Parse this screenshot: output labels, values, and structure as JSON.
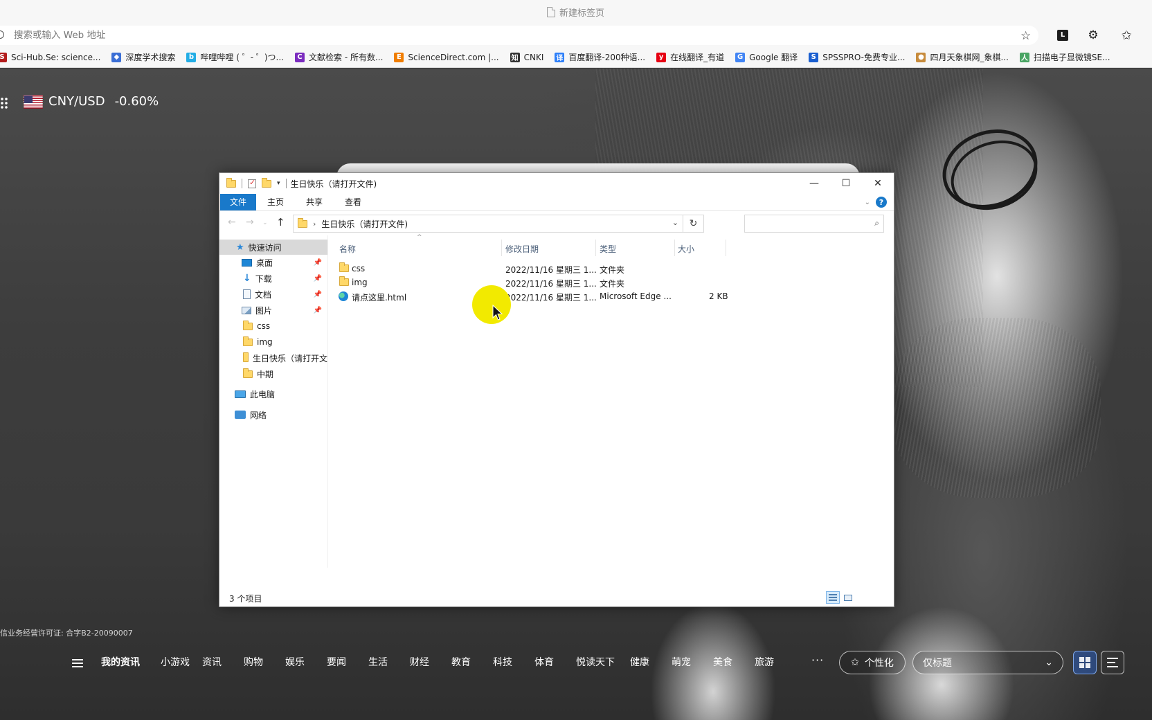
{
  "browser": {
    "tab_title": "新建标签页",
    "address_placeholder": "搜索或输入 Web 地址",
    "ext_label": "L",
    "bookmarks": [
      {
        "label": "Sci-Hub.Se: science...",
        "color": "#b31b1b",
        "glyph": "S"
      },
      {
        "label": "深度学术搜索",
        "color": "#3b6fd6",
        "glyph": "◆"
      },
      {
        "label": "哔哩哔哩 ( ゜- ゜)つ...",
        "color": "#23ade5",
        "glyph": "b"
      },
      {
        "label": "文献检索 - 所有数...",
        "color": "#7b2cbf",
        "glyph": "C"
      },
      {
        "label": "ScienceDirect.com |...",
        "color": "#f07d00",
        "glyph": "E"
      },
      {
        "label": "CNKI",
        "color": "#333333",
        "glyph": "知"
      },
      {
        "label": "百度翻译-200种语...",
        "color": "#2d7ff9",
        "glyph": "译"
      },
      {
        "label": "在线翻译_有道",
        "color": "#e60012",
        "glyph": "y"
      },
      {
        "label": "Google 翻译",
        "color": "#4285f4",
        "glyph": "G"
      },
      {
        "label": "SPSSPRO-免费专业...",
        "color": "#1a5fd0",
        "glyph": "S"
      },
      {
        "label": "四月天象棋网_象棋...",
        "color": "#c78b3c",
        "glyph": "●"
      },
      {
        "label": "扫描电子显微镜SE...",
        "color": "#4aa564",
        "glyph": "人"
      }
    ]
  },
  "newtab": {
    "currency_pair": "CNY/USD",
    "currency_change": "-0.60%",
    "license": "信业务经营许可证: 合字B2-20090007",
    "categories": [
      "我的资讯",
      "小游戏",
      "资讯",
      "购物",
      "娱乐",
      "要闻",
      "生活",
      "财经",
      "教育",
      "科技",
      "体育",
      "悦读天下",
      "健康",
      "萌宠",
      "美食",
      "旅游"
    ],
    "more": "···",
    "personalize": "个性化",
    "layout_option": "仅标题"
  },
  "explorer": {
    "title": "生日快乐（请打开文件)",
    "ribbon_tabs": {
      "file": "文件",
      "home": "主页",
      "share": "共享",
      "view": "查看"
    },
    "breadcrumb": "生日快乐（请打开文件)",
    "search_placeholder": "",
    "sidebar": {
      "quick_access": "快速访问",
      "desktop": "桌面",
      "downloads": "下载",
      "documents": "文档",
      "pictures": "图片",
      "css": "css",
      "img": "img",
      "birthday": "生日快乐（请打开文",
      "midterm": "中期",
      "this_pc": "此电脑",
      "network": "网络"
    },
    "columns": {
      "name": "名称",
      "modified": "修改日期",
      "type": "类型",
      "size": "大小"
    },
    "files": [
      {
        "name": "css",
        "modified": "2022/11/16 星期三 1...",
        "type": "文件夹",
        "size": ""
      },
      {
        "name": "img",
        "modified": "2022/11/16 星期三 1...",
        "type": "文件夹",
        "size": ""
      },
      {
        "name": "请点这里.html",
        "modified": "2022/11/16 星期三 1...",
        "type": "Microsoft Edge ...",
        "size": "2 KB"
      }
    ],
    "status": "3 个项目"
  }
}
